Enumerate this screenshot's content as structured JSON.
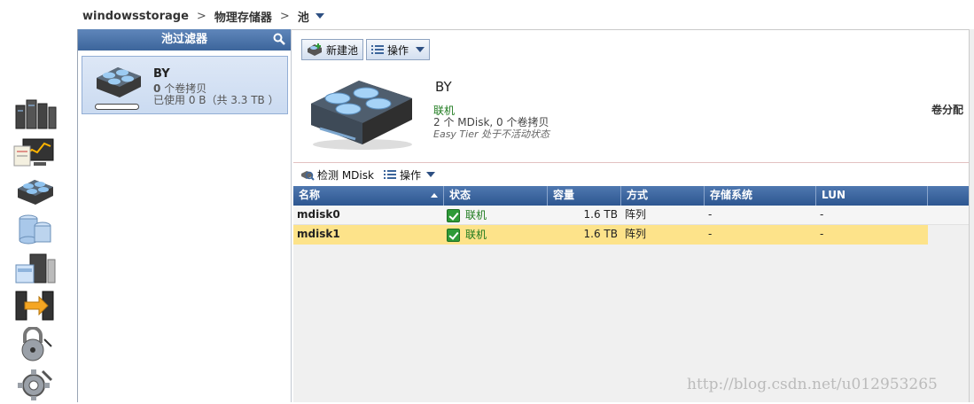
{
  "breadcrumb": {
    "host": "windowsstorage",
    "sep1": ">",
    "section": "物理存储器",
    "sep2": ">",
    "current": "池"
  },
  "left_nav": {
    "icons": [
      "servers-icon",
      "monitoring-icon",
      "pools-icon",
      "volumes-icon",
      "hosts-icon",
      "copy-services-icon",
      "access-lock-icon",
      "settings-gear-icon"
    ]
  },
  "filter_panel": {
    "title": "池过滤器",
    "search_icon": "search-icon",
    "pool": {
      "name": "BY",
      "copies_count": "0",
      "copies_label": "个卷拷贝",
      "used_text": "已使用 0 B（共 3.3 TB ）",
      "usage_fraction": 0
    }
  },
  "toolbar": {
    "new_pool_label": "新建池",
    "actions_label": "操作"
  },
  "pool_detail": {
    "name": "BY",
    "status": "联机",
    "counts": "2 个 MDisk, 0 个卷拷贝",
    "easy_tier": "Easy Tier 处于不活动状态",
    "volume_allocation": "卷分配"
  },
  "mdisk_toolbar": {
    "detect_label": "检测 MDisk",
    "actions_label": "操作"
  },
  "mdisk_table": {
    "columns": [
      "名称",
      "状态",
      "容量",
      "方式",
      "存储系统",
      "LUN"
    ],
    "rows": [
      {
        "name": "mdisk0",
        "status": "联机",
        "capacity": "1.6 TB",
        "mode": "阵列",
        "storage_system": "-",
        "lun": "-"
      },
      {
        "name": "mdisk1",
        "status": "联机",
        "capacity": "1.6 TB",
        "mode": "阵列",
        "storage_system": "-",
        "lun": "-"
      }
    ],
    "selected_row": 1
  },
  "watermark": "http://blog.csdn.net/u012953265",
  "colors": {
    "header_blue": "#3c659b",
    "selected_row": "#fde38a",
    "online_green": "#1d7a1d"
  }
}
